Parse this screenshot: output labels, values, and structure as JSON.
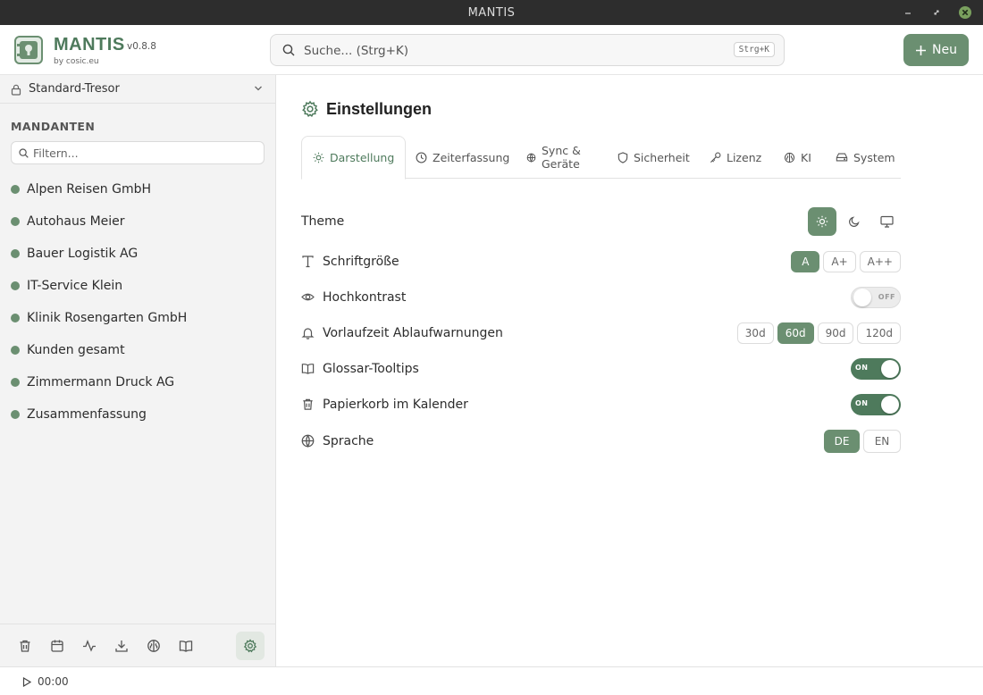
{
  "window": {
    "title": "MANTIS"
  },
  "header": {
    "brand": "MANTIS",
    "version": "v0.8.8",
    "byline": "by cosic.eu",
    "search_placeholder": "Suche... (Strg+K)",
    "search_shortcut": "Strg+K",
    "new_button": "Neu"
  },
  "sidebar": {
    "vault": "Standard-Tresor",
    "section_title": "MANDANTEN",
    "filter_placeholder": "Filtern...",
    "clients": [
      "Alpen Reisen GmbH",
      "Autohaus Meier",
      "Bauer Logistik AG",
      "IT-Service Klein",
      "Klinik Rosengarten GmbH",
      "Kunden gesamt",
      "Zimmermann Druck AG",
      "Zusammenfassung"
    ],
    "tools": [
      "trash-icon",
      "calendar-icon",
      "activity-icon",
      "download-icon",
      "brain-icon",
      "book-icon",
      "gear-icon"
    ]
  },
  "statusbar": {
    "timer": "00:00"
  },
  "settings": {
    "title": "Einstellungen",
    "tabs": {
      "darstellung": "Darstellung",
      "zeiterfassung": "Zeiterfassung",
      "sync_line1": "Sync &",
      "sync_line2": "Geräte",
      "sicherheit": "Sicherheit",
      "lizenz": "Lizenz",
      "ki": "KI",
      "system": "System"
    },
    "active_tab": "Darstellung",
    "theme": {
      "label": "Theme",
      "options": [
        "sun-icon",
        "moon-icon",
        "monitor-icon"
      ],
      "selected": "sun-icon"
    },
    "font_size": {
      "label": "Schriftgröße",
      "options": [
        "A",
        "A+",
        "A++"
      ],
      "selected": "A"
    },
    "high_contrast": {
      "label": "Hochkontrast",
      "state": "OFF"
    },
    "lead_time": {
      "label": "Vorlaufzeit Ablaufwarnungen",
      "options": [
        "30d",
        "60d",
        "90d",
        "120d"
      ],
      "selected": "60d"
    },
    "glossary": {
      "label": "Glossar-Tooltips",
      "state": "ON"
    },
    "trash_calendar": {
      "label": "Papierkorb im Kalender",
      "state": "ON"
    },
    "language": {
      "label": "Sprache",
      "options": [
        "DE",
        "EN"
      ],
      "selected": "DE"
    }
  },
  "colors": {
    "accent": "#6b8f71",
    "accent_dark": "#4e7a5c",
    "titlebar": "#2d2d2d",
    "close": "#7aa05e"
  }
}
